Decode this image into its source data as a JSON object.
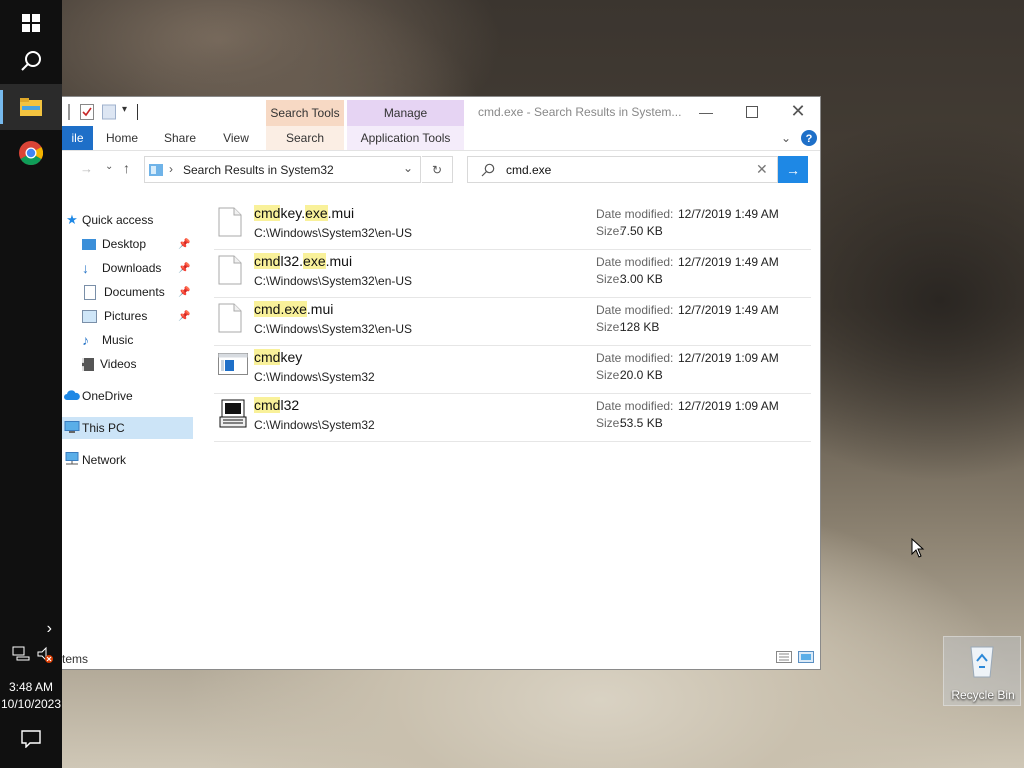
{
  "taskbar": {
    "icons": [
      "windows-start-icon",
      "search-icon",
      "file-explorer-icon",
      "chrome-icon"
    ],
    "time": "3:48 AM",
    "date": "10/10/2023"
  },
  "window": {
    "title": "cmd.exe - Search Results in System...",
    "context_tabs": {
      "search_tools": "Search Tools",
      "manage": "Manage"
    },
    "ribbon_tabs": [
      "ile",
      "Home",
      "Share",
      "View",
      "Search",
      "Application Tools"
    ],
    "address": {
      "location": "Search Results in System32"
    },
    "search": {
      "value": "cmd.exe"
    }
  },
  "nav": {
    "items": [
      {
        "label": "Quick access",
        "icon": "star-icon",
        "pinned": false
      },
      {
        "label": "Desktop",
        "icon": "desktop-icon",
        "pinned": true
      },
      {
        "label": "Downloads",
        "icon": "download-icon",
        "pinned": true
      },
      {
        "label": "Documents",
        "icon": "document-icon",
        "pinned": true
      },
      {
        "label": "Pictures",
        "icon": "pictures-icon",
        "pinned": true
      },
      {
        "label": "Music",
        "icon": "music-icon",
        "pinned": false
      },
      {
        "label": "Videos",
        "icon": "videos-icon",
        "pinned": false
      },
      {
        "label": "OneDrive",
        "icon": "cloud-icon",
        "pinned": false
      },
      {
        "label": "This PC",
        "icon": "computer-icon",
        "pinned": false
      },
      {
        "label": "Network",
        "icon": "network-icon",
        "pinned": false
      }
    ],
    "selected": "This PC"
  },
  "results": {
    "date_label": "Date modified:",
    "size_label": "Size:",
    "files": [
      {
        "name_parts": [
          [
            "cmd",
            true
          ],
          [
            "key.",
            false
          ],
          [
            "exe",
            true
          ],
          [
            ".mui",
            false
          ]
        ],
        "path": "C:\\Windows\\System32\\en-US",
        "date": "12/7/2019 1:49 AM",
        "size": "7.50 KB",
        "icon": "blank-file-icon"
      },
      {
        "name_parts": [
          [
            "cmd",
            true
          ],
          [
            "l32.",
            false
          ],
          [
            "exe",
            true
          ],
          [
            ".mui",
            false
          ]
        ],
        "path": "C:\\Windows\\System32\\en-US",
        "date": "12/7/2019 1:49 AM",
        "size": "3.00 KB",
        "icon": "blank-file-icon"
      },
      {
        "name_parts": [
          [
            "cmd.exe",
            true
          ],
          [
            ".mui",
            false
          ]
        ],
        "path": "C:\\Windows\\System32\\en-US",
        "date": "12/7/2019 1:49 AM",
        "size": "128 KB",
        "icon": "blank-file-icon"
      },
      {
        "name_parts": [
          [
            "cmd",
            true
          ],
          [
            "key",
            false
          ]
        ],
        "path": "C:\\Windows\\System32",
        "date": "12/7/2019 1:09 AM",
        "size": "20.0 KB",
        "icon": "app-window-icon"
      },
      {
        "name_parts": [
          [
            "cmd",
            true
          ],
          [
            "l32",
            false
          ]
        ],
        "path": "C:\\Windows\\System32",
        "date": "12/7/2019 1:09 AM",
        "size": "53.5 KB",
        "icon": "dialer-app-icon"
      }
    ]
  },
  "status": {
    "text": "tems"
  },
  "desktop": {
    "recycle_bin_label": "Recycle Bin"
  },
  "colors": {
    "accent": "#1e88e5",
    "highlight": "#f9f19a",
    "search_tools_tab": "#f7d9c4",
    "manage_tab": "#e6d4f3"
  }
}
